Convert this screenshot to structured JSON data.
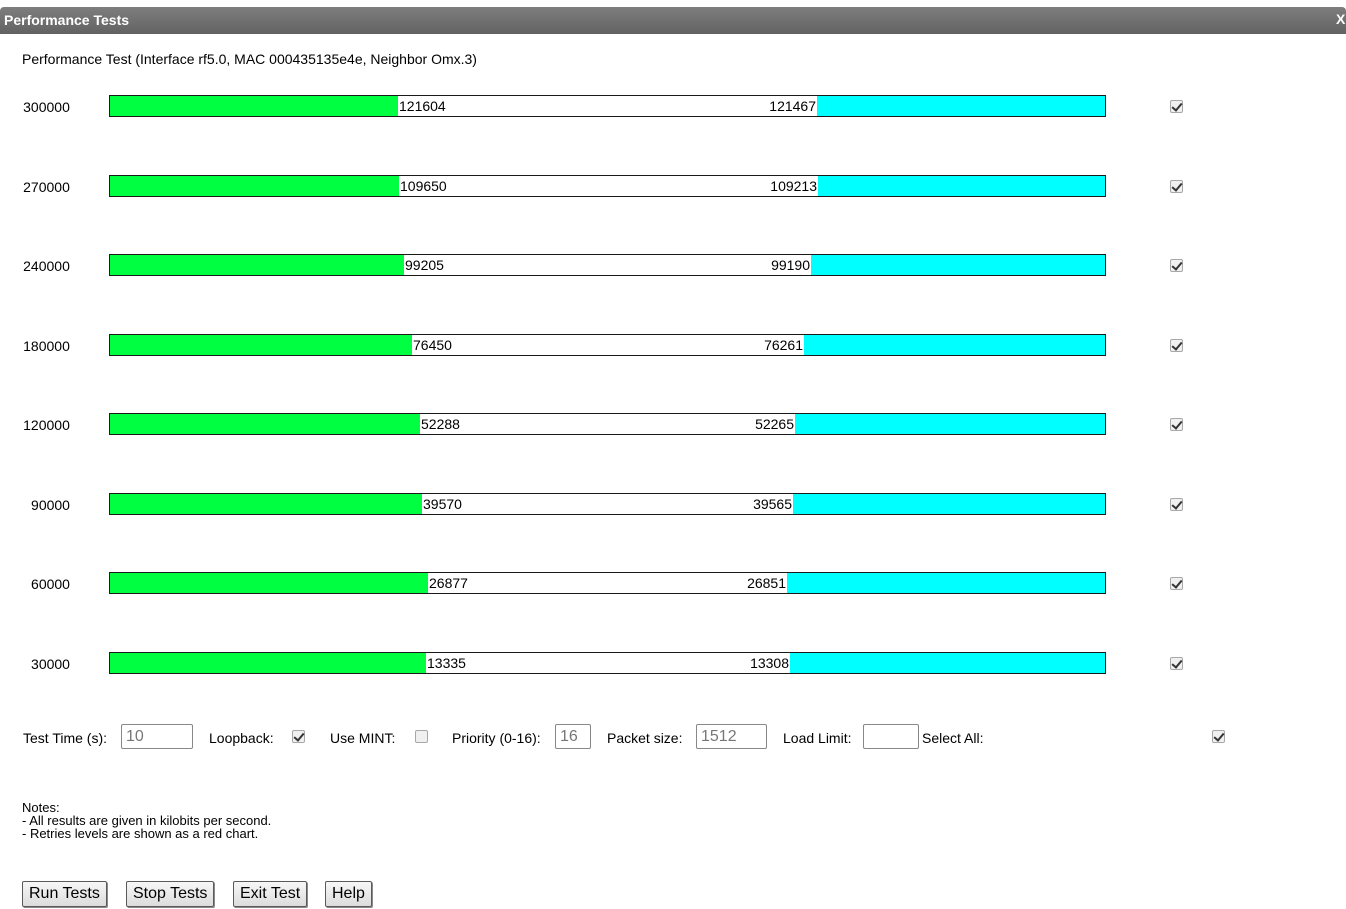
{
  "window": {
    "title": "Performance Tests",
    "close_label": "X"
  },
  "heading": "Performance Test (Interface rf5.0, MAC 000435135e4e, Neighbor Omx.3)",
  "colors": {
    "forward_bar": "#00ff40",
    "reverse_bar": "#00ffff"
  },
  "rows": [
    {
      "load": "300000",
      "forward": "121604",
      "reverse": "121467",
      "forward_value": 121604,
      "reverse_value": 121467,
      "capacity": 300000,
      "selected": true
    },
    {
      "load": "270000",
      "forward": "109650",
      "reverse": "109213",
      "forward_value": 109650,
      "reverse_value": 109213,
      "capacity": 270000,
      "selected": true
    },
    {
      "load": "240000",
      "forward": "99205",
      "reverse": "99190",
      "forward_value": 99205,
      "reverse_value": 99190,
      "capacity": 240000,
      "selected": true
    },
    {
      "load": "180000",
      "forward": "76450",
      "reverse": "76261",
      "forward_value": 76450,
      "reverse_value": 76261,
      "capacity": 180000,
      "selected": true
    },
    {
      "load": "120000",
      "forward": "52288",
      "reverse": "52265",
      "forward_value": 52288,
      "reverse_value": 52265,
      "capacity": 120000,
      "selected": true
    },
    {
      "load": "90000",
      "forward": "39570",
      "reverse": "39565",
      "forward_value": 39570,
      "reverse_value": 39565,
      "capacity": 90000,
      "selected": true
    },
    {
      "load": "60000",
      "forward": "26877",
      "reverse": "26851",
      "forward_value": 26877,
      "reverse_value": 26851,
      "capacity": 60000,
      "selected": true
    },
    {
      "load": "30000",
      "forward": "13335",
      "reverse": "13308",
      "forward_value": 13335,
      "reverse_value": 13308,
      "capacity": 30000,
      "selected": true
    }
  ],
  "controls": {
    "test_time_label": "Test Time (s):",
    "test_time_value": "10",
    "loopback_label": "Loopback:",
    "loopback_checked": true,
    "use_mint_label": "Use MINT:",
    "use_mint_checked": false,
    "priority_label": "Priority (0-16):",
    "priority_value": "16",
    "packet_size_label": "Packet size:",
    "packet_size_value": "1512",
    "load_limit_label": "Load Limit:",
    "load_limit_value": "",
    "select_all_label": "Select All:",
    "select_all_checked": true
  },
  "notes": {
    "title": "Notes:",
    "lines": [
      "- All results are given in kilobits per second.",
      "- Retries levels are shown as a red chart."
    ]
  },
  "buttons": {
    "run": "Run Tests",
    "stop": "Stop Tests",
    "exit": "Exit Test",
    "help": "Help"
  }
}
